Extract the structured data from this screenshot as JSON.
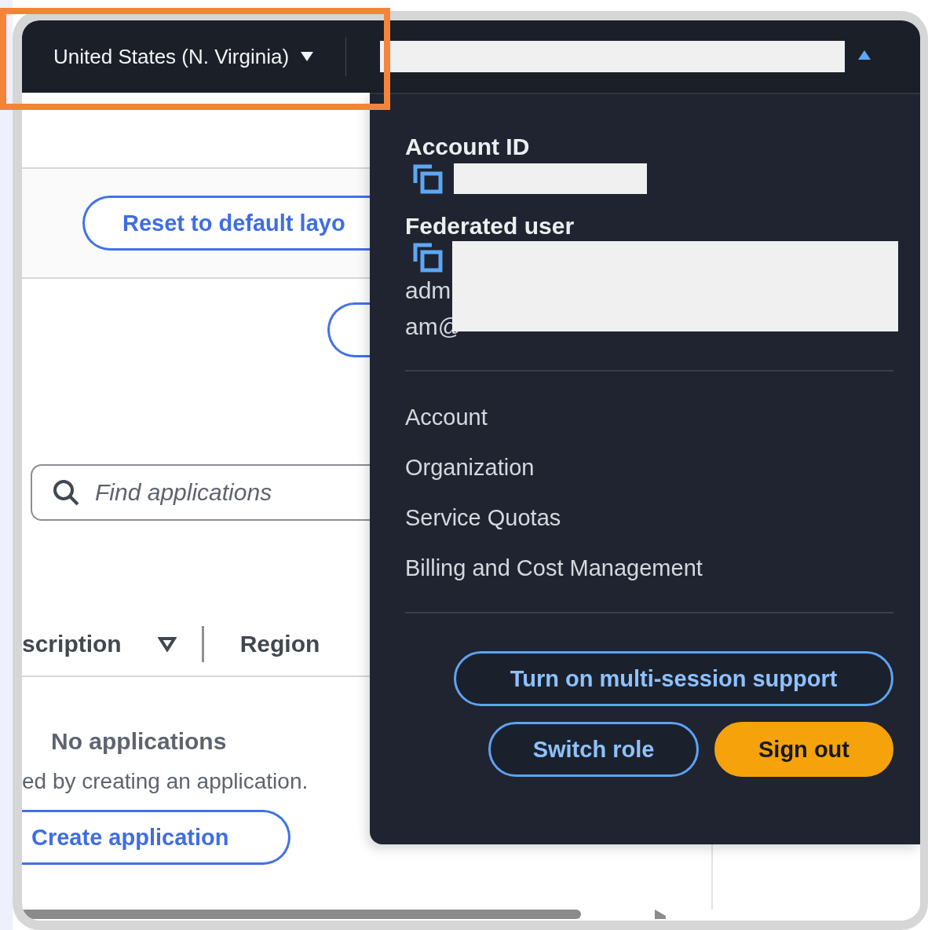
{
  "region_selector": {
    "label": "United States (N. Virginia)",
    "expanded": false
  },
  "account_menu": {
    "expanded": true
  },
  "page": {
    "reset_button": "Reset to default layo",
    "search": {
      "placeholder": "Find applications"
    },
    "columns": [
      "scription",
      "Region"
    ],
    "empty_title": "No applications",
    "empty_text": "ed by creating an application.",
    "create_button": "Create application"
  },
  "menu": {
    "account_id_label": "Account ID",
    "federated_user_label": "Federated user",
    "user_fragments": [
      "adm",
      "am@"
    ],
    "links": [
      "Account",
      "Organization",
      "Service Quotas",
      "Billing and Cost Management"
    ],
    "buttons": [
      {
        "label": "Turn on multi-session support",
        "kind": "secondary"
      },
      {
        "label": "Switch role",
        "kind": "secondary"
      },
      {
        "label": "Sign out",
        "kind": "primary"
      }
    ]
  }
}
